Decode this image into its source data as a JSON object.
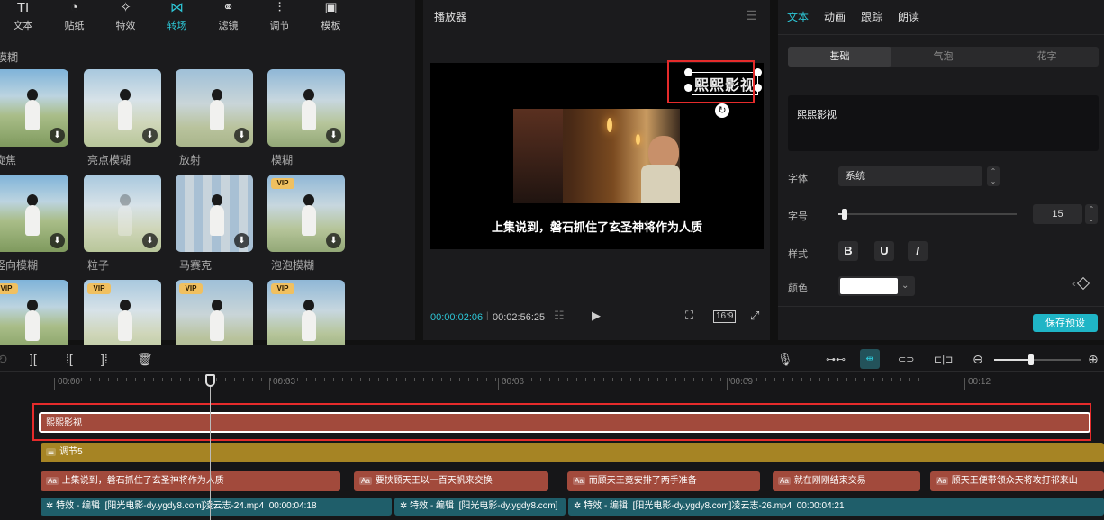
{
  "toolbar": {
    "tabs": [
      {
        "icon": "text-icon",
        "glyph": "TI",
        "label": "文本"
      },
      {
        "icon": "sticker-icon",
        "glyph": "◔",
        "label": "贴纸"
      },
      {
        "icon": "effects-icon",
        "glyph": "✧",
        "label": "特效"
      },
      {
        "icon": "transition-icon",
        "glyph": "⋈",
        "label": "转场"
      },
      {
        "icon": "filter-icon",
        "glyph": "⚭",
        "label": "滤镜"
      },
      {
        "icon": "adjust-icon",
        "glyph": "⫶",
        "label": "调节"
      },
      {
        "icon": "template-icon",
        "glyph": "▣",
        "label": "模板"
      }
    ],
    "active_tab": "转场"
  },
  "transitions": {
    "category": "模糊",
    "items": [
      {
        "label": "旋焦",
        "vip": false
      },
      {
        "label": "亮点模糊",
        "vip": false
      },
      {
        "label": "放射",
        "vip": false
      },
      {
        "label": "模糊",
        "vip": false
      },
      {
        "label": "竖向模糊",
        "vip": false
      },
      {
        "label": "粒子",
        "vip": false
      },
      {
        "label": "马赛克",
        "vip": false
      },
      {
        "label": "泡泡模糊",
        "vip": true
      },
      {
        "label": "",
        "vip": true
      },
      {
        "label": "",
        "vip": true
      },
      {
        "label": "",
        "vip": true
      },
      {
        "label": "",
        "vip": true
      }
    ],
    "vip_label": "VIP"
  },
  "player": {
    "title": "播放器",
    "watermark_text": "熙熙影视",
    "subtitle": "上集说到，磐石抓住了玄圣神将作为人质",
    "current_time": "00:00:02:06",
    "total_time": "00:02:56:25",
    "ratio": "16:9"
  },
  "inspector": {
    "tabs": [
      "文本",
      "动画",
      "跟踪",
      "朗读"
    ],
    "active_tab": "文本",
    "segments": [
      "基础",
      "气泡",
      "花字"
    ],
    "active_segment": "基础",
    "text_value": "熙熙影视",
    "font_label": "字体",
    "font_value": "系统",
    "size_label": "字号",
    "size_value": "15",
    "size_fraction": 0.02,
    "style_label": "样式",
    "style_buttons": [
      "B",
      "U",
      "I"
    ],
    "color_label": "颜色",
    "color_value": "#ffffff",
    "save_label": "保存预设"
  },
  "timeline": {
    "ruler": [
      "00:00",
      "00:03",
      "00:06",
      "00:09",
      "00:12"
    ],
    "tracks": {
      "watermark_clip": "熙熙影视",
      "adjust_clip": "调节5",
      "text_clips": [
        "上集说到，磐石抓住了玄圣神将作为人质",
        "要挟顾天王以一百天帆来交换",
        "而顾天王竟安排了两手准备",
        "就在刚刚结束交易",
        "顾天王便带领众天将攻打祁来山"
      ],
      "fx_clips": [
        {
          "label": "特效 - 编辑",
          "file": "[阳光电影-dy.ygdy8.com]凌云志-24.mp4",
          "time": "00:00:04:18"
        },
        {
          "label": "特效 - 编辑",
          "file": "[阳光电影-dy.ygdy8.com]",
          "time": ""
        },
        {
          "label": "特效 - 编辑",
          "file": "[阳光电影-dy.ygdy8.com]凌云志-26.mp4",
          "time": "00:00:04:21"
        }
      ]
    }
  },
  "colors": {
    "accent": "#2dc6d6",
    "highlight_box": "#e52b2b",
    "text_clip": "#a24a3c",
    "adjust_clip": "#a68424"
  }
}
